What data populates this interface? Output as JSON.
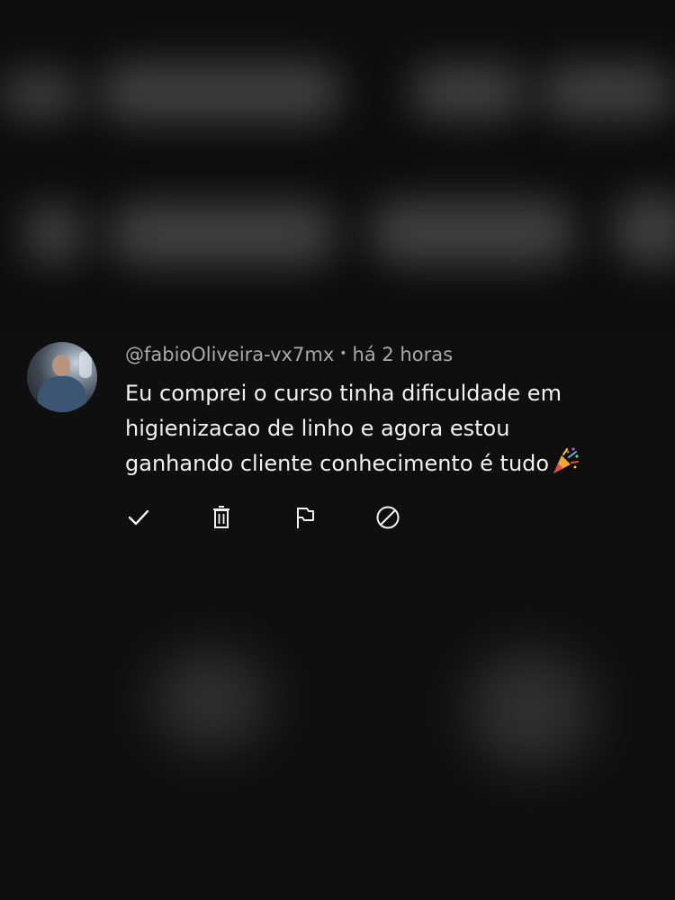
{
  "comment": {
    "author": "@fabioOliveira-vx7mx",
    "separator": "•",
    "time": "há 2 horas",
    "text_lines": [
      "Eu comprei o curso tinha dificuldade em",
      "higienizacao de linho e agora estou",
      "ganhando cliente conhecimento é tudo"
    ],
    "emoji": "party-popper-icon"
  },
  "actions": [
    {
      "name": "approve",
      "icon": "check-icon"
    },
    {
      "name": "delete",
      "icon": "trash-icon"
    },
    {
      "name": "report",
      "icon": "flag-icon"
    },
    {
      "name": "block",
      "icon": "block-icon"
    }
  ],
  "colors": {
    "background": "#0f0f0f",
    "text_primary": "#f1f1f1",
    "text_secondary": "#aaaaaa"
  }
}
